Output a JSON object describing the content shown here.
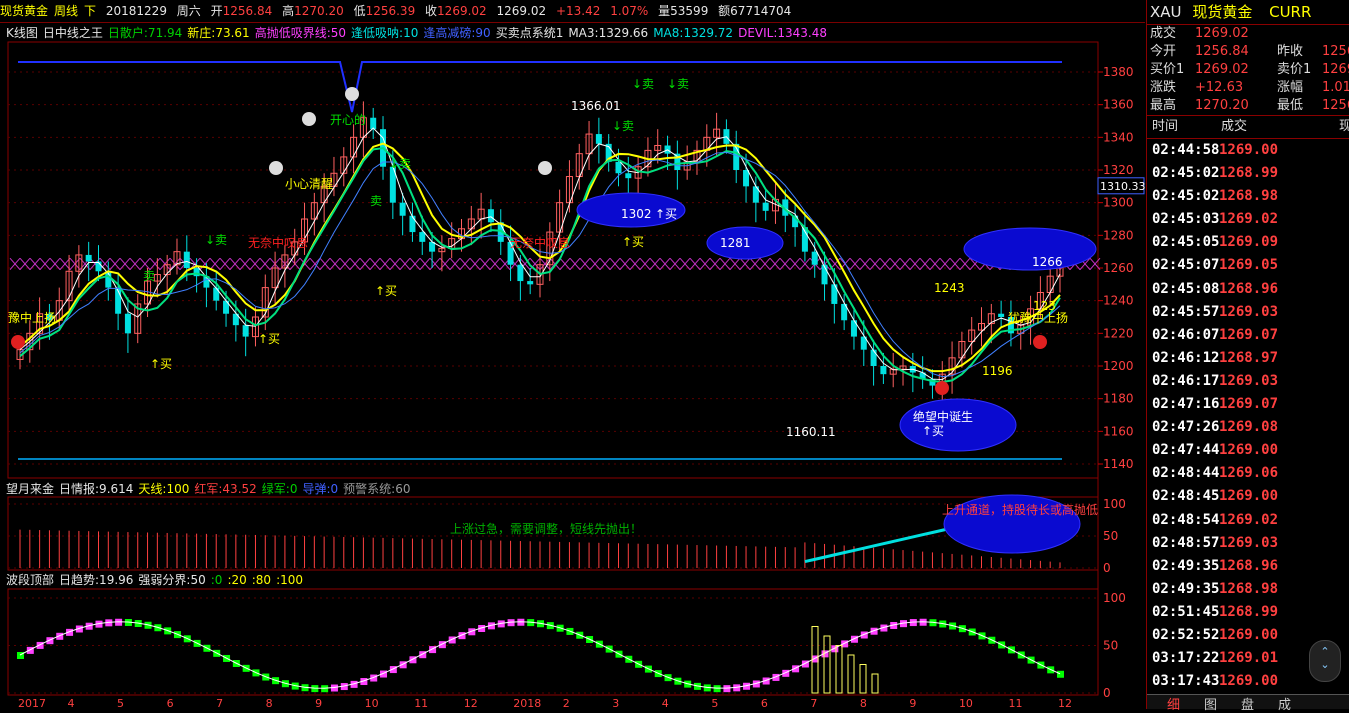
{
  "top_bar": {
    "name": "现货黄金",
    "period": "周线",
    "arrow": "下",
    "date": "20181229",
    "weekday": "周六",
    "open_label": "开",
    "open": "1256.84",
    "high_label": "高",
    "high": "1270.20",
    "low_label": "低",
    "low": "1256.39",
    "close_label": "收",
    "close": "1269.02",
    "price": "1269.02",
    "change": "+13.42",
    "change_pct": "1.07%",
    "volume": "量53599",
    "amount": "额67714704"
  },
  "main_indicator": {
    "name": "K线图",
    "sub": "日中线之王",
    "items": [
      {
        "text": "日散户:71.94",
        "color": "#00d000"
      },
      {
        "text": "新庄:73.61",
        "color": "#ffff00"
      },
      {
        "text": "高抛低吸界线:50",
        "color": "#ff40ff"
      },
      {
        "text": "逢低吸呐:10",
        "color": "#00e0e0"
      },
      {
        "text": "逢高减磅:90",
        "color": "#4060ff"
      },
      {
        "text": "买卖点系统1",
        "color": "#e6e6e6"
      },
      {
        "text": "MA3:1329.66",
        "color": "#e6e6e6"
      },
      {
        "text": "MA8:1329.72",
        "color": "#00e0e0"
      },
      {
        "text": "DEVIL:1343.48",
        "color": "#ff40ff"
      }
    ]
  },
  "price_axis": [
    "1380",
    "1360",
    "1340",
    "1320",
    "1300",
    "1280",
    "1260",
    "1240",
    "1220",
    "1200",
    "1180",
    "1160",
    "1140"
  ],
  "price_tag": "1310.33",
  "annotations": {
    "hi_1366": "1366.01",
    "lo_1160": "1160.11",
    "lvl_1302": "1302",
    "buy": "↑买",
    "sell": "↓卖",
    "buy_text": "买",
    "sell_text": "卖",
    "lvl_1281": "1281",
    "lvl_1266": "1266",
    "lvl_1243": "1243",
    "lvl_1196": "1196",
    "lvl_123": "123",
    "txt_wuhai": "无奈中叹息",
    "txt_xiaoxin": "小心清醒",
    "txt_juewang": "绝望中诞生",
    "txt_chouchang": "犹豫中上扬",
    "txt_shangzhang": "上扬",
    "txt_lefttop": "豫中上扬",
    "txt_leaf": "开心的"
  },
  "mid_indicator": {
    "name": "望月来金",
    "sub": "日情报:9.614",
    "items": [
      {
        "text": "天线:100",
        "color": "#ffff00"
      },
      {
        "text": "红军:43.52",
        "color": "#ff4040"
      },
      {
        "text": "绿军:0",
        "color": "#00d000"
      },
      {
        "text": "导弹:0",
        "color": "#4060ff"
      },
      {
        "text": "预警系统:60",
        "color": "#999999"
      }
    ],
    "axis": [
      "100",
      "50",
      "0"
    ],
    "note1": "上涨过急，需要调整，短线先抛出！",
    "note2": "上升通道，持股待长或高抛低"
  },
  "low_indicator": {
    "name": "波段顶部",
    "sub": "日趋势:19.96",
    "items": [
      {
        "text": "强弱分界:50",
        "color": "#e6e6e6"
      },
      {
        "text": ":0",
        "color": "#00d000"
      },
      {
        "text": ":20",
        "color": "#ffff00"
      },
      {
        "text": ":80",
        "color": "#ffff00"
      },
      {
        "text": ":100",
        "color": "#ffff00"
      }
    ],
    "axis": [
      "100",
      "50",
      "0"
    ]
  },
  "time_axis": [
    "2017",
    "4",
    "5",
    "6",
    "7",
    "8",
    "9",
    "10",
    "11",
    "12",
    "2018",
    "2",
    "3",
    "4",
    "5",
    "6",
    "7",
    "8",
    "9",
    "10",
    "11",
    "12"
  ],
  "right_panel": {
    "symbol": "XAU",
    "name": "现货黄金",
    "curr": "CURR",
    "quotes": [
      {
        "l1": "成交",
        "v1": "1269.02",
        "l2": "",
        "v2": ""
      },
      {
        "l1": "今开",
        "v1": "1256.84",
        "l2": "昨收",
        "v2": "1256"
      },
      {
        "l1": "买价1",
        "v1": "1269.02",
        "l2": "卖价1",
        "v2": "1269"
      },
      {
        "l1": "涨跌",
        "v1": "+12.63",
        "l2": "涨幅",
        "v2": "1.01"
      },
      {
        "l1": "最高",
        "v1": "1270.20",
        "l2": "最低",
        "v2": "1256"
      }
    ],
    "tick_header": {
      "time": "时间",
      "deal": "成交",
      "now": "现"
    },
    "ticks": [
      {
        "t": "02:44:58",
        "p": "1269.00"
      },
      {
        "t": "02:45:02",
        "p": "1268.99"
      },
      {
        "t": "02:45:02",
        "p": "1268.98"
      },
      {
        "t": "02:45:03",
        "p": "1269.02"
      },
      {
        "t": "02:45:05",
        "p": "1269.09"
      },
      {
        "t": "02:45:07",
        "p": "1269.05"
      },
      {
        "t": "02:45:08",
        "p": "1268.96"
      },
      {
        "t": "02:45:57",
        "p": "1269.03"
      },
      {
        "t": "02:46:07",
        "p": "1269.07"
      },
      {
        "t": "02:46:12",
        "p": "1268.97"
      },
      {
        "t": "02:46:17",
        "p": "1269.03"
      },
      {
        "t": "02:47:16",
        "p": "1269.07"
      },
      {
        "t": "02:47:26",
        "p": "1269.08"
      },
      {
        "t": "02:47:44",
        "p": "1269.00"
      },
      {
        "t": "02:48:44",
        "p": "1269.06"
      },
      {
        "t": "02:48:45",
        "p": "1269.00"
      },
      {
        "t": "02:48:54",
        "p": "1269.02"
      },
      {
        "t": "02:48:57",
        "p": "1269.03"
      },
      {
        "t": "02:49:35",
        "p": "1268.96"
      },
      {
        "t": "02:49:35",
        "p": "1268.98"
      },
      {
        "t": "02:51:45",
        "p": "1268.99"
      },
      {
        "t": "02:52:52",
        "p": "1269.00"
      },
      {
        "t": "03:17:22",
        "p": "1269.01"
      },
      {
        "t": "03:17:43",
        "p": "1269.00"
      }
    ],
    "tabs": [
      "细",
      "图",
      "盘",
      "成"
    ]
  },
  "colors": {
    "up": "#ff40ff",
    "down": "#00e0e0",
    "frame": "#8a0000",
    "grid": "#5a0000"
  }
}
